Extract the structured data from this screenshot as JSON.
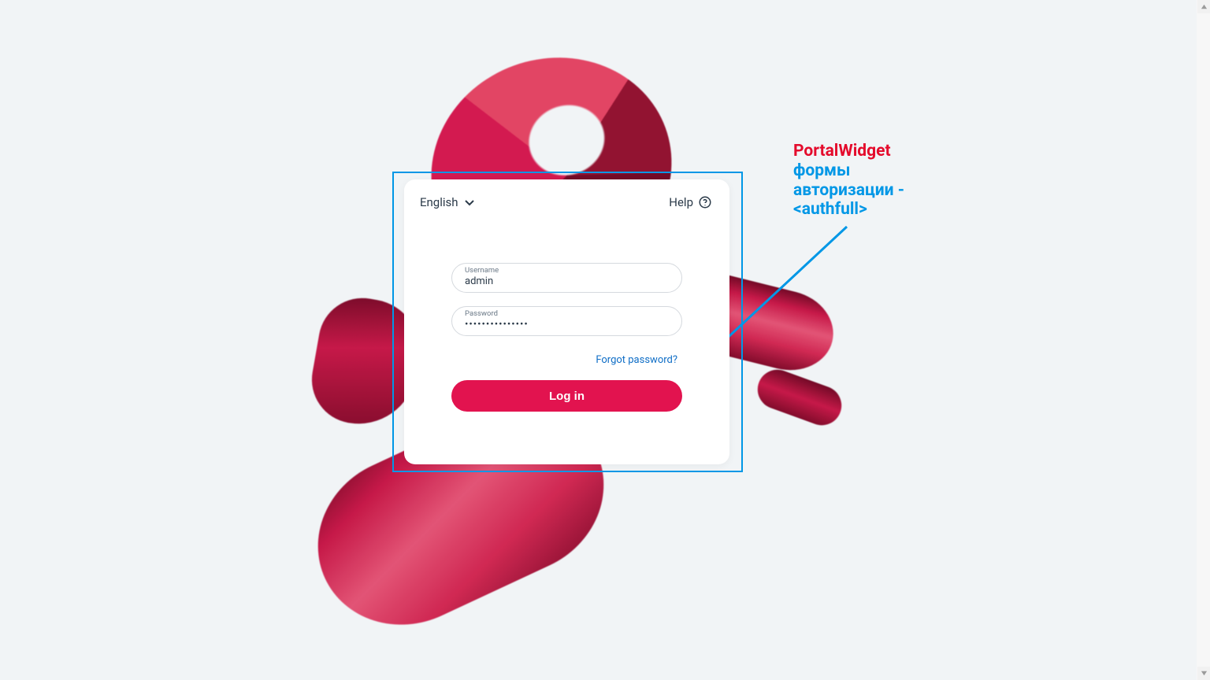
{
  "annotation": {
    "title": "PortalWidget",
    "line1": "формы",
    "line2": "авторизации -",
    "line3": "<authfull>"
  },
  "card": {
    "language": {
      "current": "English"
    },
    "help": {
      "label": "Help"
    },
    "fields": {
      "username": {
        "label": "Username",
        "value": "admin"
      },
      "password": {
        "label": "Password",
        "value": "•••••••••••••••"
      }
    },
    "links": {
      "forgot": "Forgot password?"
    },
    "buttons": {
      "login": "Log in"
    }
  },
  "colors": {
    "accent": "#e2134f",
    "annotation_blue": "#0097e6",
    "link": "#0e6dc6"
  }
}
